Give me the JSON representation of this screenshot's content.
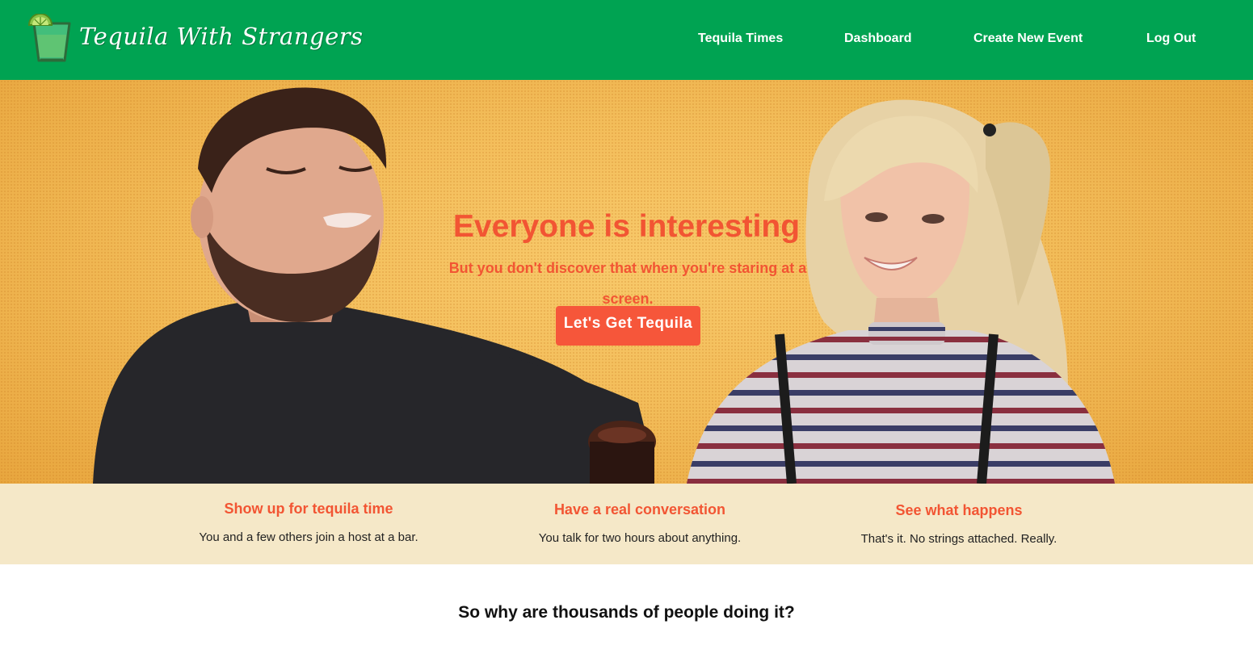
{
  "header": {
    "logo_text": "Tequila With Strangers",
    "nav": [
      {
        "label": "Tequila Times"
      },
      {
        "label": "Dashboard"
      },
      {
        "label": "Create New Event"
      },
      {
        "label": "Log Out"
      }
    ]
  },
  "hero": {
    "title": "Everyone is interesting",
    "subtitle": "But you don't discover that when you're staring at a screen.",
    "button_label": "Let's Get Tequila"
  },
  "steps": [
    {
      "title": "Show up for tequila time",
      "text": "You and a few others join a host at a bar."
    },
    {
      "title": "Have a real conversation",
      "text": "You talk for two hours about anything."
    },
    {
      "title": "See what happens",
      "text": "That's it. No strings attached. Really."
    }
  ],
  "why": {
    "heading": "So why are thousands of people doing it?"
  },
  "colors": {
    "header_bg": "#00a352",
    "accent": "#f25533",
    "button_bg": "#f6563a",
    "steps_bg": "#f5e8c8",
    "hero_bg": "#f3bd5a"
  },
  "icons": {
    "logo": "shot-glass-lime-icon"
  }
}
